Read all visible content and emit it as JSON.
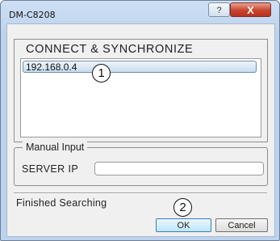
{
  "window": {
    "title": "DM-C8208",
    "help_label": "?",
    "close_label": "X"
  },
  "connect": {
    "title": "CONNECT & SYNCHRONIZE",
    "items": [
      {
        "label": "192.168.0.4"
      }
    ]
  },
  "manual": {
    "legend": "Manual Input",
    "server_ip_label": "SERVER IP",
    "server_ip_value": ""
  },
  "status": {
    "text": "Finished Searching"
  },
  "buttons": {
    "ok_label": "OK",
    "cancel_label": "Cancel"
  },
  "markers": {
    "first": "1",
    "second": "2"
  },
  "colors": {
    "frame": "#bcd3ee",
    "close_button": "#c8452e",
    "selection": "#c9dcee"
  }
}
